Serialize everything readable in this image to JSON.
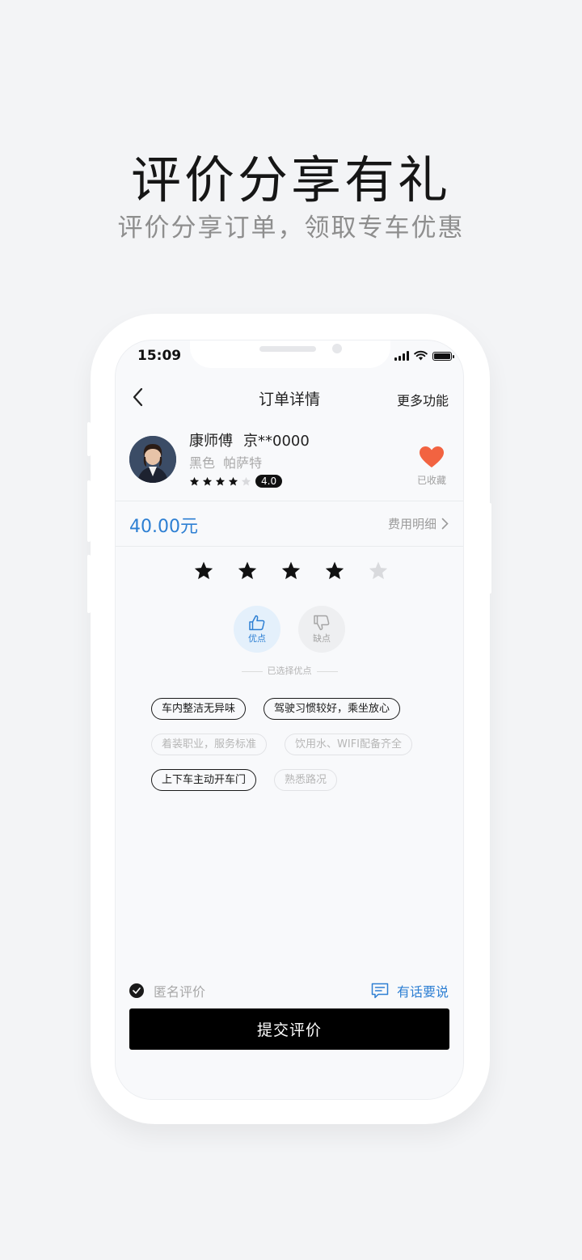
{
  "promo": {
    "title": "评价分享有礼",
    "subtitle": "评价分享订单，领取专车优惠"
  },
  "status_bar": {
    "time": "15:09"
  },
  "nav": {
    "back_icon": "chevron-left-icon",
    "title": "订单详情",
    "more": "更多功能"
  },
  "driver": {
    "name": "康师傅",
    "plate": "京**0000",
    "car": "黑色  帕萨特",
    "rating": "4.0",
    "rating_stars": 4,
    "favorite_label": "已收藏",
    "favorite_color": "#f26341"
  },
  "fare": {
    "price": "40.00元",
    "detail_label": "费用明细"
  },
  "review": {
    "stars_selected": 4,
    "stars_total": 5,
    "pro_label": "优点",
    "con_label": "缺点",
    "selected_hint": "已选择优点",
    "tags": [
      {
        "label": "车内整洁无异味",
        "selected": true
      },
      {
        "label": "驾驶习惯较好，乘坐放心",
        "selected": true
      },
      {
        "label": "着装职业，服务标准",
        "selected": false
      },
      {
        "label": "饮用水、WIFI配备齐全",
        "selected": false
      },
      {
        "label": "上下车主动开车门",
        "selected": true
      },
      {
        "label": "熟悉路况",
        "selected": false
      }
    ]
  },
  "footer": {
    "anonymous_label": "匿名评价",
    "comment_label": "有话要说",
    "submit_label": "提交评价"
  },
  "colors": {
    "accent_blue": "#2d7fd3",
    "heart": "#f26341",
    "button_bg": "#000000"
  }
}
